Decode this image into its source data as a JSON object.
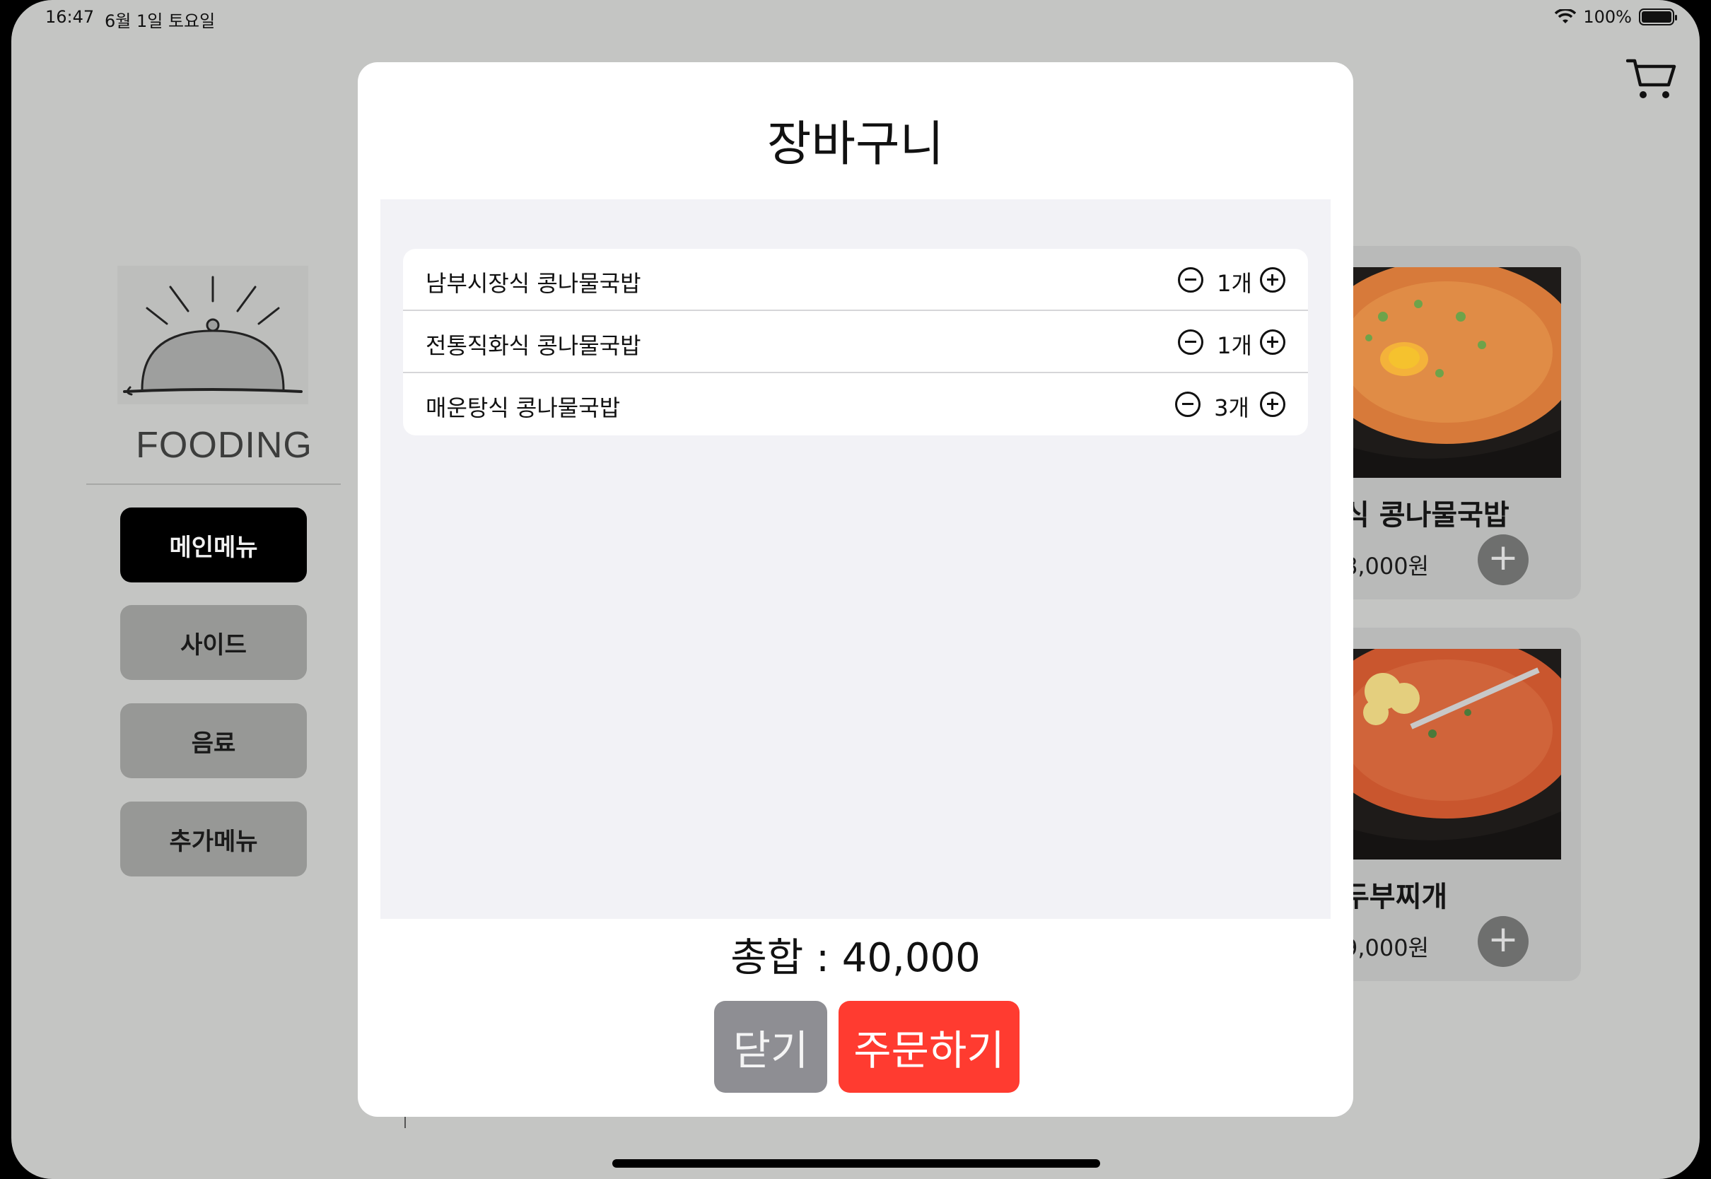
{
  "status_bar": {
    "time": "16:47",
    "date": "6월 1일 토요일",
    "battery": "100%",
    "battery_level": 1.0
  },
  "sidebar": {
    "brand": "FOODING",
    "items": [
      {
        "label": "메인메뉴",
        "active": true
      },
      {
        "label": "사이드",
        "active": false
      },
      {
        "label": "음료",
        "active": false
      },
      {
        "label": "추가메뉴",
        "active": false
      }
    ]
  },
  "products": [
    {
      "name": "식 콩나물국밥",
      "price": "8,000원",
      "add": "+"
    },
    {
      "name": "두부찌개",
      "price": "9,000원",
      "add": "+"
    }
  ],
  "cart_modal": {
    "title": "장바구니",
    "items": [
      {
        "name": "남부시장식 콩나물국밥",
        "quantity": "1개"
      },
      {
        "name": "전통직화식 콩나물국밥",
        "quantity": "1개"
      },
      {
        "name": "매운탕식 콩나물국밥",
        "quantity": "3개"
      }
    ],
    "total_label": "총합 : 40,000",
    "close_label": "닫기",
    "order_label": "주문하기"
  },
  "colors": {
    "accent_order": "#ff3b30",
    "close_button": "#8e8e93",
    "active_menu": "#000000"
  },
  "icons": [
    "wifi-icon",
    "battery-icon",
    "cart-icon",
    "food-cloche-icon",
    "minus-circle-icon",
    "plus-circle-icon"
  ]
}
